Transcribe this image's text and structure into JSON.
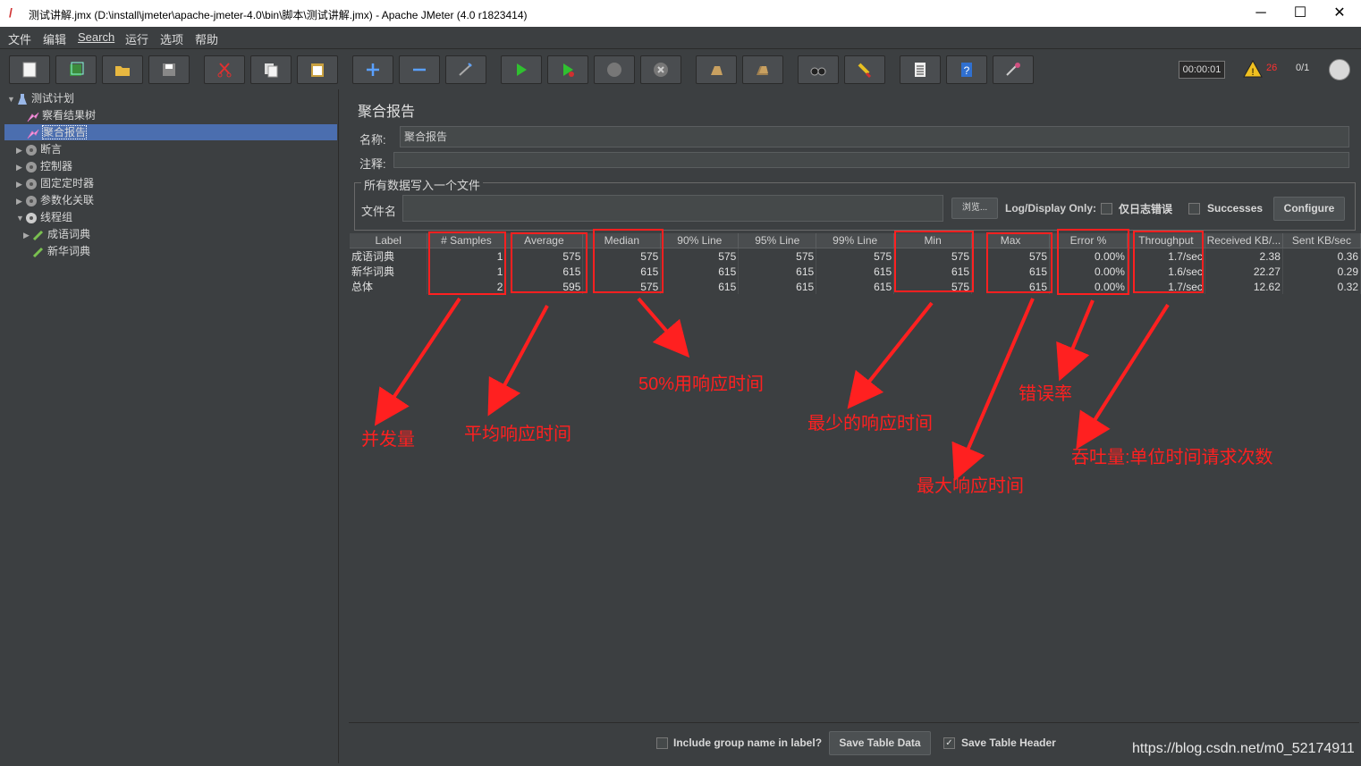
{
  "window": {
    "title": "测试讲解.jmx (D:\\install\\jmeter\\apache-jmeter-4.0\\bin\\脚本\\测试讲解.jmx) - Apache JMeter (4.0 r1823414)",
    "minimize": "─",
    "maximize": "☐",
    "close": "✕"
  },
  "menu": [
    "文件",
    "编辑",
    "Search",
    "运行",
    "选项",
    "帮助"
  ],
  "status": {
    "timer": "00:00:01",
    "warning_count": "26",
    "threads": "0/1"
  },
  "tree": {
    "root": "测试计划",
    "items": [
      {
        "label": "察看结果树",
        "icon": "chart-icon"
      },
      {
        "label": "聚合报告",
        "icon": "chart-icon",
        "selected": true
      },
      {
        "label": "断言",
        "icon": "gear-icon"
      },
      {
        "label": "控制器",
        "icon": "gear-icon"
      },
      {
        "label": "固定定时器",
        "icon": "gear-icon"
      },
      {
        "label": "参数化关联",
        "icon": "gear-icon"
      },
      {
        "label": "线程组",
        "icon": "gear-icon"
      },
      {
        "label": "成语词典",
        "icon": "pipette-icon"
      },
      {
        "label": "新华词典",
        "icon": "pipette-icon"
      }
    ]
  },
  "panel": {
    "title": "聚合报告",
    "name_label": "名称:",
    "name_value": "聚合报告",
    "comment_label": "注释:",
    "group_title": "所有数据写入一个文件",
    "file_label": "文件名",
    "browse_label": "浏览...",
    "log_display_label": "Log/Display Only:",
    "errors_only_label": "仅日志错误",
    "successes_label": "Successes",
    "configure_label": "Configure"
  },
  "table": {
    "headers": [
      "Label",
      "# Samples",
      "Average",
      "Median",
      "90% Line",
      "95% Line",
      "99% Line",
      "Min",
      "Max",
      "Error %",
      "Throughput",
      "Received KB/...",
      "Sent KB/sec"
    ],
    "rows": [
      [
        "成语词典",
        "1",
        "575",
        "575",
        "575",
        "575",
        "575",
        "575",
        "575",
        "0.00%",
        "1.7/sec",
        "2.38",
        "0.36"
      ],
      [
        "新华词典",
        "1",
        "615",
        "615",
        "615",
        "615",
        "615",
        "615",
        "615",
        "0.00%",
        "1.6/sec",
        "22.27",
        "0.29"
      ],
      [
        "总体",
        "2",
        "595",
        "575",
        "615",
        "615",
        "615",
        "575",
        "615",
        "0.00%",
        "1.7/sec",
        "12.62",
        "0.32"
      ]
    ]
  },
  "annotations": {
    "samples": "并发量",
    "average": "平均响应时间",
    "median": "50%用响应时间",
    "min": "最少的响应时间",
    "max": "最大响应时间",
    "error": "错误率",
    "throughput": "吞吐量:单位时间请求次数",
    "color": "#ff2020"
  },
  "footer": {
    "include_group_label": "Include group name in label?",
    "save_table_data": "Save Table Data",
    "save_table_header": "Save Table Header"
  },
  "watermark": "https://blog.csdn.net/m0_52174911"
}
